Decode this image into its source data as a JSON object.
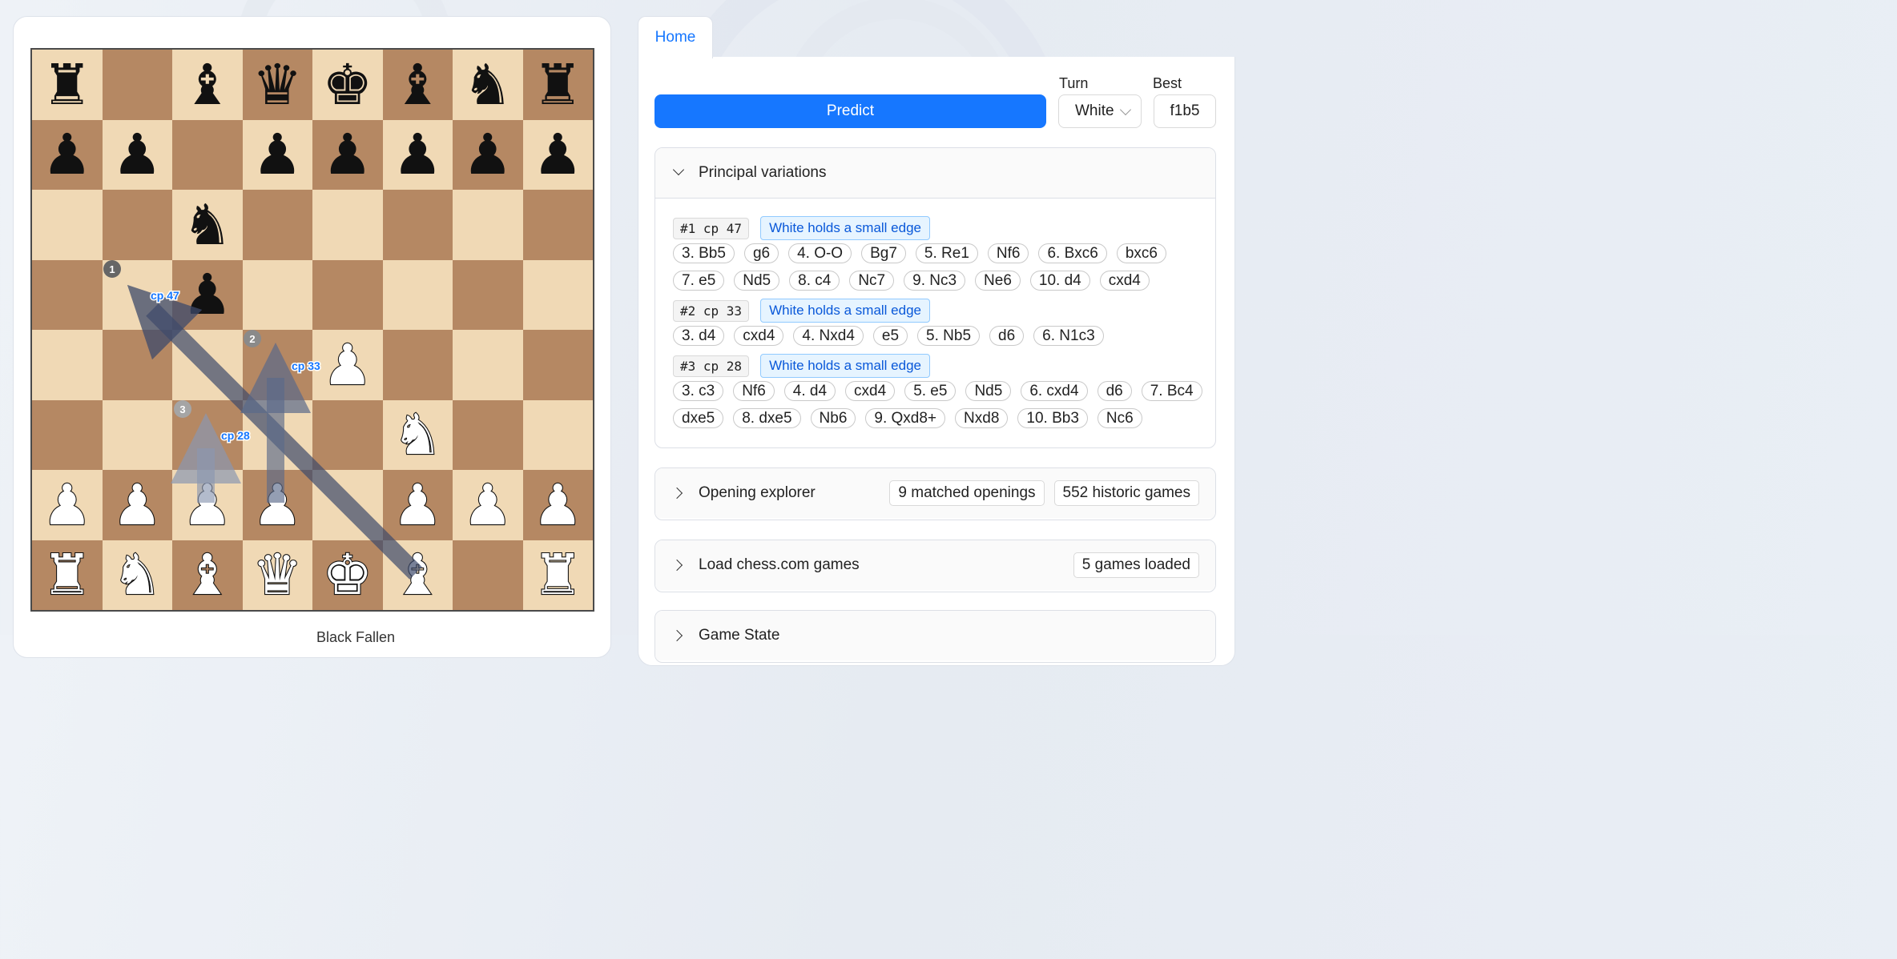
{
  "board": {
    "ranks": [
      [
        "r-b",
        "",
        "b-b",
        "q-b",
        "k-b",
        "b-b",
        "n-b",
        "r-b"
      ],
      [
        "p-b",
        "p-b",
        "",
        "p-b",
        "p-b",
        "p-b",
        "p-b",
        "p-b"
      ],
      [
        "",
        "",
        "n-b",
        "",
        "",
        "",
        "",
        ""
      ],
      [
        "",
        "",
        "p-b",
        "",
        "",
        "",
        "",
        ""
      ],
      [
        "",
        "",
        "",
        "",
        "p-w",
        "",
        "",
        ""
      ],
      [
        "",
        "",
        "",
        "",
        "",
        "n-w",
        "",
        ""
      ],
      [
        "p-w",
        "p-w",
        "p-w",
        "p-w",
        "",
        "p-w",
        "p-w",
        "p-w"
      ],
      [
        "r-w",
        "n-w",
        "b-w",
        "q-w",
        "k-w",
        "b-w",
        "",
        "r-w"
      ]
    ],
    "arrows": [
      {
        "num": "1",
        "label": "cp 47",
        "color": "#3d4a6b"
      },
      {
        "num": "2",
        "label": "cp 33",
        "color": "#5a6a8a"
      },
      {
        "num": "3",
        "label": "cp 28",
        "color": "#8a97b0"
      }
    ],
    "bottom_text": "Black       Fallen"
  },
  "tabs": {
    "home": "Home"
  },
  "controls": {
    "predict_label": "Predict",
    "turn_label": "Turn",
    "turn_value": "White",
    "best_label": "Best",
    "best_value": "f1b5"
  },
  "principal_variations": {
    "title": "Principal variations",
    "lines": [
      {
        "code": "#1  cp  47",
        "badge": "White holds a small edge",
        "moves": [
          "3. Bb5",
          "g6",
          "4. O-O",
          "Bg7",
          "5. Re1",
          "Nf6",
          "6. Bxc6",
          "bxc6",
          "7. e5",
          "Nd5",
          "8. c4",
          "Nc7",
          "9. Nc3",
          "Ne6",
          "10. d4",
          "cxd4"
        ]
      },
      {
        "code": "#2  cp  33",
        "badge": "White holds a small edge",
        "moves": [
          "3. d4",
          "cxd4",
          "4. Nxd4",
          "e5",
          "5. Nb5",
          "d6",
          "6. N1c3"
        ]
      },
      {
        "code": "#3  cp  28",
        "badge": "White holds a small edge",
        "moves": [
          "3. c3",
          "Nf6",
          "4. d4",
          "cxd4",
          "5. e5",
          "Nd5",
          "6. cxd4",
          "d6",
          "7. Bc4",
          "dxe5",
          "8. dxe5",
          "Nb6",
          "9. Qxd8+",
          "Nxd8",
          "10. Bb3",
          "Nc6"
        ]
      }
    ]
  },
  "opening_explorer": {
    "title": "Opening explorer",
    "matched": "9 matched openings",
    "historic": "552 historic games"
  },
  "chesscom": {
    "title": "Load chess.com games",
    "loaded": "5 games loaded"
  },
  "game_state": {
    "title": "Game State"
  },
  "colors": {
    "accent": "#1677ff",
    "light_square": "#f0d9b5",
    "dark_square": "#b58863"
  }
}
